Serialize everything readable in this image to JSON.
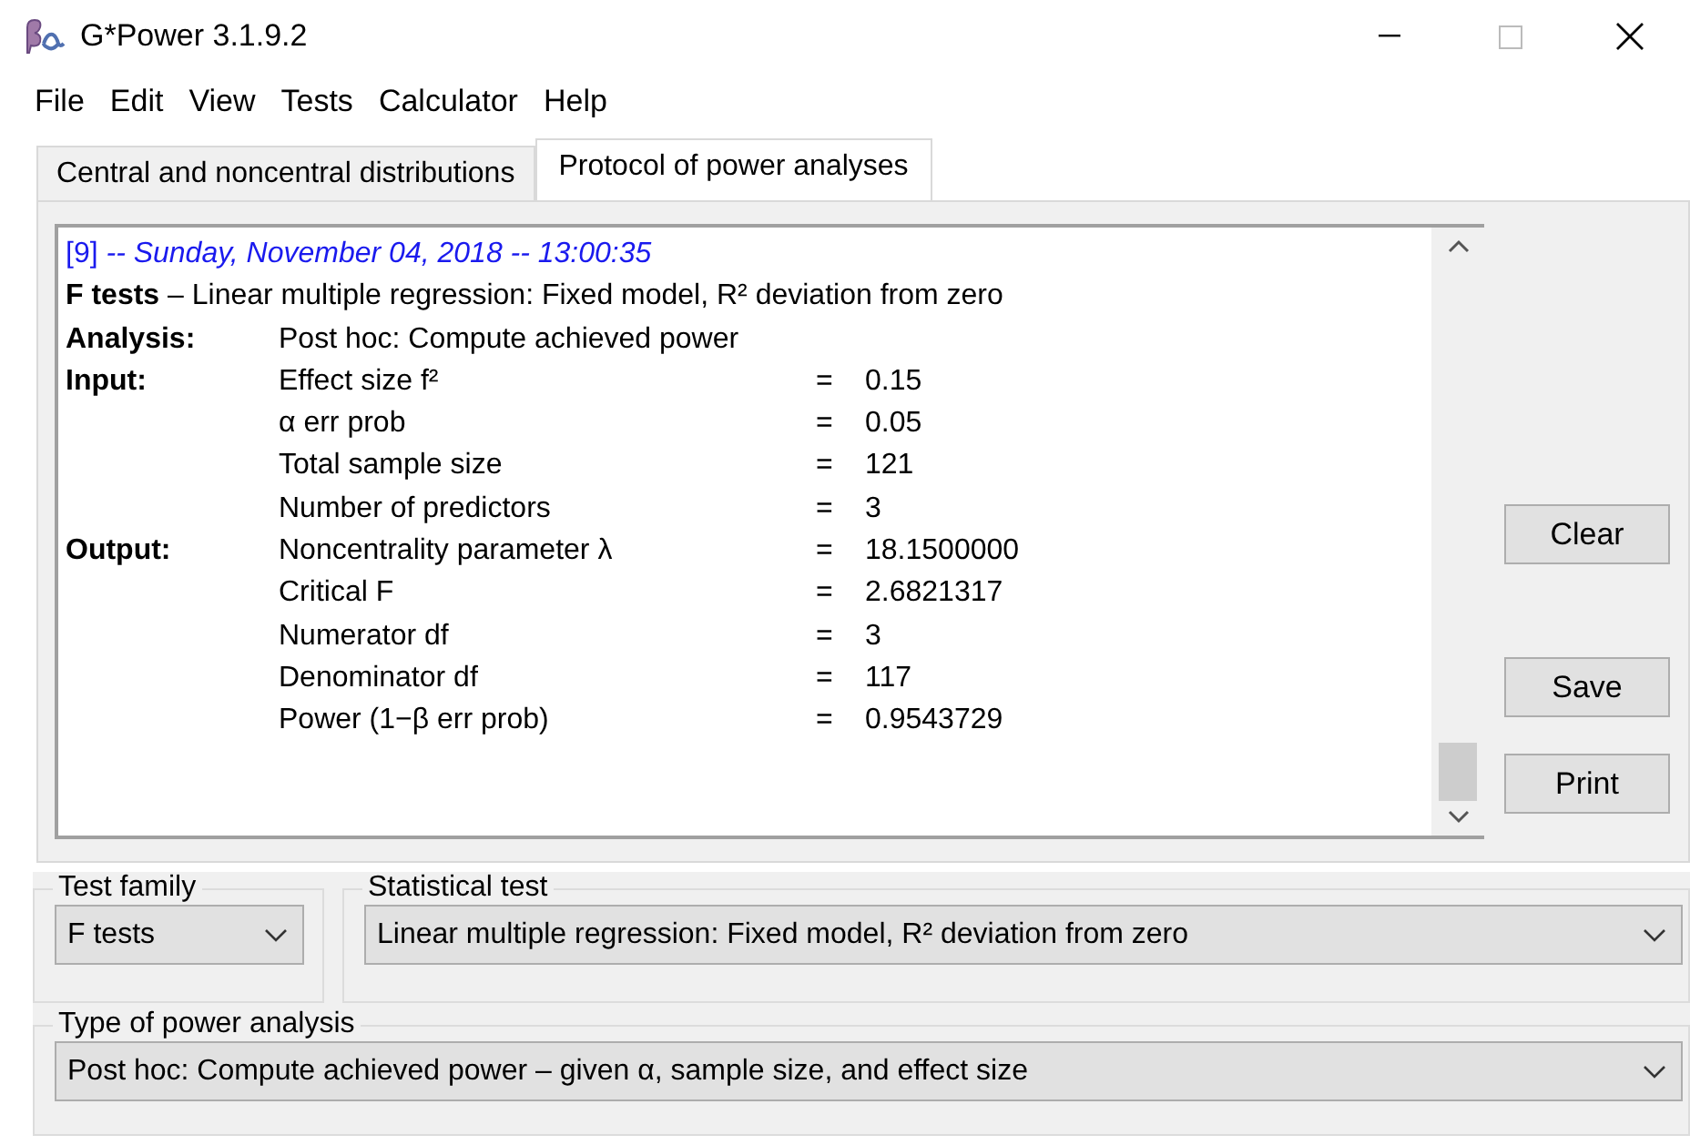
{
  "window": {
    "title": "G*Power 3.1.9.2"
  },
  "menu": [
    "File",
    "Edit",
    "View",
    "Tests",
    "Calculator",
    "Help"
  ],
  "tabs": [
    {
      "label": "Central and noncentral distributions",
      "selected": false
    },
    {
      "label": "Protocol of power analyses",
      "selected": true
    }
  ],
  "protocol": {
    "header": "[9] *-- Sunday, November 04, 2018 -- 13:00:35*",
    "test_line": "**F tests** – Linear multiple regression: Fixed model, R² deviation from zero",
    "sections": [
      {
        "label": "Analysis:",
        "rows": [
          {
            "name": "Post hoc: Compute achieved power"
          }
        ]
      },
      {
        "label": "Input:",
        "rows": [
          {
            "name": "Effect size f²",
            "equals": "=",
            "value": "0.15"
          },
          {
            "name": "α err prob",
            "equals": "=",
            "value": "0.05"
          },
          {
            "name": "Total sample size",
            "equals": "=",
            "value": "121"
          },
          {
            "name": "Number of predictors",
            "equals": "=",
            "value": "3"
          }
        ]
      },
      {
        "label": "Output:",
        "rows": [
          {
            "name": "Noncentrality parameter λ",
            "equals": "=",
            "value": "18.1500000"
          },
          {
            "name": "Critical F",
            "equals": "=",
            "value": "2.6821317"
          },
          {
            "name": "Numerator df",
            "equals": "=",
            "value": "3"
          },
          {
            "name": "Denominator df",
            "equals": "=",
            "value": "117"
          },
          {
            "name": "Power (1−β err prob)",
            "equals": "=",
            "value": "0.9543729"
          }
        ]
      }
    ]
  },
  "buttons": [
    "Clear",
    "Save",
    "Print"
  ],
  "test_family": {
    "legend": "Test family",
    "value": "F tests"
  },
  "statistical_test": {
    "legend": "Statistical test",
    "value": "Linear multiple regression: Fixed model, R² deviation from zero"
  },
  "type_of_power_analysis": {
    "legend": "Type of power analysis",
    "value": "Post hoc: Compute achieved power – given α, sample size, and effect size"
  }
}
